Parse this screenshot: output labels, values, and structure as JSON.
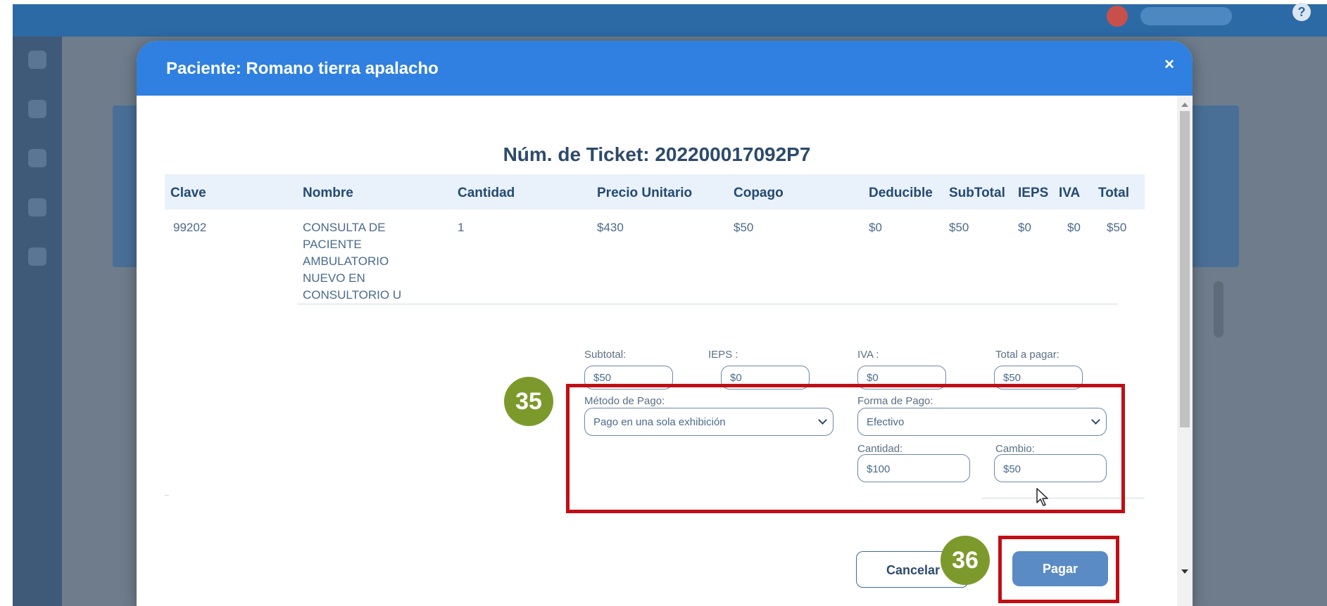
{
  "modal": {
    "title": "Paciente: Romano tierra apalacho",
    "close_glyph": "×",
    "ticket_title": "Núm. de Ticket: 202200017092P7"
  },
  "table": {
    "headers": [
      "Clave",
      "Nombre",
      "Cantidad",
      "Precio Unitario",
      "Copago",
      "Deducible",
      "SubTotal",
      "IEPS",
      "IVA",
      "Total"
    ],
    "rows": [
      {
        "clave": "99202",
        "nombre": "CONSULTA DE PACIENTE AMBULATORIO NUEVO EN CONSULTORIO U",
        "cantidad": "1",
        "precio_unitario": "$430",
        "copago": "$50",
        "deducible": "$0",
        "subtotal": "$50",
        "ieps": "$0",
        "iva": "$0",
        "total": "$50"
      }
    ]
  },
  "totals": {
    "subtotal_label": "Subtotal:",
    "subtotal_value": "$50",
    "ieps_label": "IEPS :",
    "ieps_value": "$0",
    "iva_label": "IVA :",
    "iva_value": "$0",
    "total_label": "Total a pagar:",
    "total_value": "$50"
  },
  "payment": {
    "metodo_label": "Método de Pago:",
    "metodo_value": "Pago en una sola exhibición",
    "forma_label": "Forma de Pago:",
    "forma_value": "Efectivo",
    "cantidad_label": "Cantidad:",
    "cantidad_value": "$100",
    "cambio_label": "Cambio:",
    "cambio_value": "$50"
  },
  "actions": {
    "cancel_label": "Cancelar",
    "pay_label": "Pagar"
  },
  "callouts": {
    "step_35": "35",
    "step_36": "36",
    "highlight_color": "#bf0f14",
    "badge_color": "#7c9a2b"
  },
  "theme": {
    "header_color": "#2f80e0",
    "pay_button_color": "#5b8bc4"
  }
}
